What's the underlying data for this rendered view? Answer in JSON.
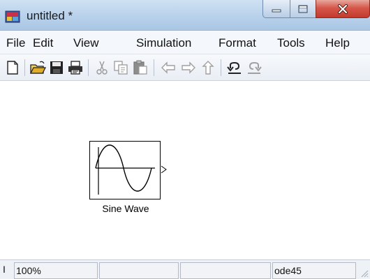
{
  "window": {
    "title": "untitled *",
    "icon": "simulink-model-icon"
  },
  "menu": [
    "File",
    "Edit",
    "View",
    "Simulation",
    "Format",
    "Tools",
    "Help"
  ],
  "toolbar": {
    "icons": [
      "new-icon",
      "open-icon",
      "save-icon",
      "print-icon",
      "cut-icon",
      "copy-icon",
      "paste-icon",
      "back-icon",
      "forward-icon",
      "up-icon",
      "undo-icon",
      "redo-icon"
    ]
  },
  "canvas": {
    "block": {
      "label": "Sine Wave",
      "icon": "sine-wave-icon"
    }
  },
  "status": {
    "prefix": "I",
    "zoom": "100%",
    "cell2": "",
    "cell3": "",
    "solver": "ode45"
  },
  "colors": {
    "titlebar": "#bcd4ec",
    "close_button": "#c23a2c",
    "canvas": "#ffffff"
  }
}
